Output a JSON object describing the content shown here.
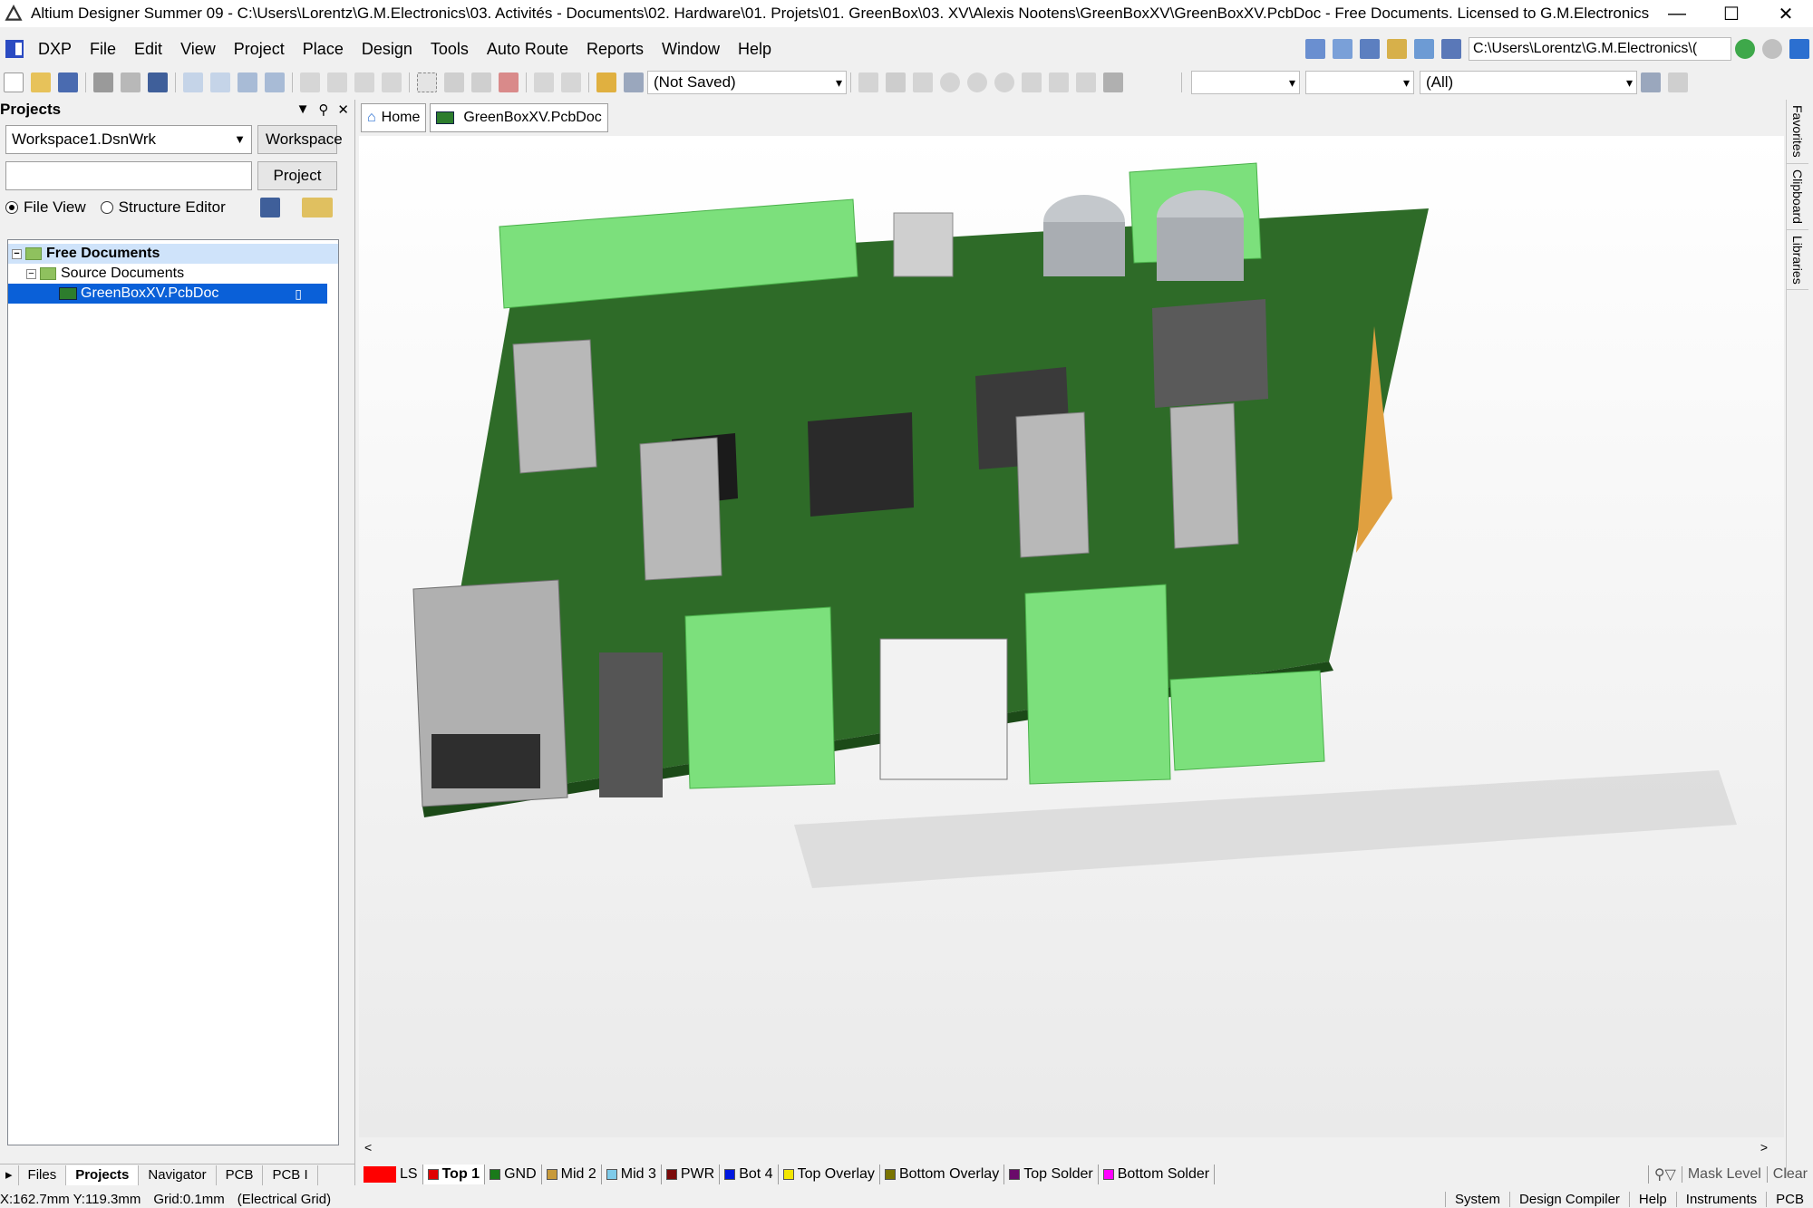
{
  "window": {
    "title": "Altium Designer Summer 09 - C:\\Users\\Lorentz\\G.M.Electronics\\03. Activités - Documents\\02. Hardware\\01. Projets\\01. GreenBox\\03. XV\\Alexis Nootens\\GreenBoxXV\\GreenBoxXV.PcbDoc - Free Documents. Licensed to G.M.Electronics. ...",
    "minimize": "—",
    "maximize": "☐",
    "close": "✕"
  },
  "menu": {
    "dxp": "DXP",
    "items": [
      "File",
      "Edit",
      "View",
      "Project",
      "Place",
      "Design",
      "Tools",
      "Auto Route",
      "Reports",
      "Window",
      "Help"
    ],
    "path": "C:\\Users\\Lorentz\\G.M.Electronics\\("
  },
  "toolbar": {
    "saved_state": "(Not Saved)",
    "filter_all": "(All)"
  },
  "projects_panel": {
    "title": "Projects",
    "workspace_value": "Workspace1.DsnWrk",
    "workspace_button": "Workspace",
    "project_value": "",
    "project_button": "Project",
    "file_view": "File View",
    "structure_editor": "Structure Editor",
    "tree": {
      "root": "Free Documents",
      "folder": "Source Documents",
      "file": "GreenBoxXV.PcbDoc"
    },
    "tabs": [
      "Files",
      "Projects",
      "Navigator",
      "PCB",
      "PCB I"
    ]
  },
  "doc_tabs": {
    "home": "Home",
    "pcb": "GreenBoxXV.PcbDoc"
  },
  "right_rail": [
    "Favorites",
    "Clipboard",
    "Libraries"
  ],
  "layers": {
    "ls": "LS",
    "tabs": [
      {
        "name": "Top 1",
        "color": "#e00000"
      },
      {
        "name": "GND",
        "color": "#1a7a1a"
      },
      {
        "name": "Mid 2",
        "color": "#c89a3a"
      },
      {
        "name": "Mid 3",
        "color": "#7ecbea"
      },
      {
        "name": "PWR",
        "color": "#7a0a0a"
      },
      {
        "name": "Bot 4",
        "color": "#0018e0"
      },
      {
        "name": "Top Overlay",
        "color": "#f2e600"
      },
      {
        "name": "Bottom Overlay",
        "color": "#7a7400"
      },
      {
        "name": "Top Solder",
        "color": "#6a0a6a"
      },
      {
        "name": "Bottom Solder",
        "color": "#ff00ff"
      }
    ],
    "mask_level": "Mask Level",
    "clear": "Clear"
  },
  "status": {
    "coords": "X:162.7mm Y:119.3mm",
    "grid": "Grid:0.1mm",
    "grid_type": "(Electrical Grid)",
    "right": [
      "System",
      "Design Compiler",
      "Help",
      "Instruments",
      "PCB"
    ]
  }
}
